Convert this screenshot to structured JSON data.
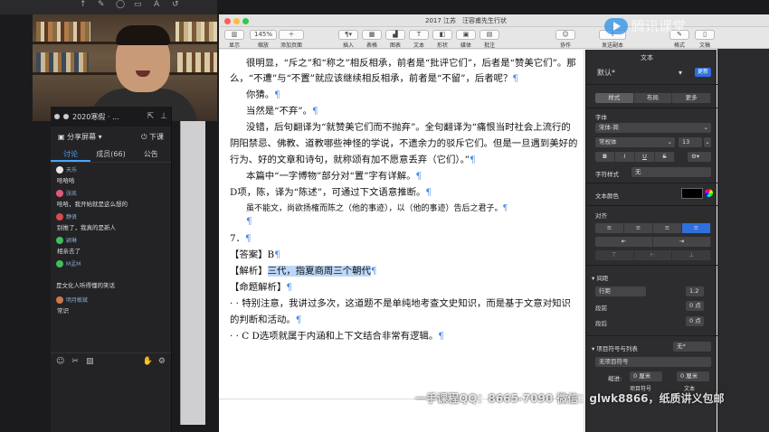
{
  "doc_title": "2017 江苏　汪容甫先生行状",
  "toolbar": {
    "view": "显示",
    "zoom_value": "145%",
    "zoom": "缩放",
    "add_page": "添加页面",
    "insert": "插入",
    "table": "表格",
    "chart": "图表",
    "text": "文本",
    "shape": "形状",
    "media": "媒体",
    "comment": "批注",
    "collaborate": "协作",
    "publish": "发送副本",
    "format": "格式",
    "document": "文稿"
  },
  "document": {
    "lines": [
      "很明显，“斥之”和“称之”相反相承，前者是“批评它们”，后者是“赞美它们”。那",
      "么，“不遭”与“不置”就应该继续相反相承，前者是“不留”，后者呢？",
      "你猜。",
      "当然是“不弃”。",
      "没错，后句翻译为“就赞美它们而不抛弃”。全句翻译为“痛恨当时社会上流行的",
      "阴阳禁忌、佛教、道教哪些神怪的学说，不遗余力的驳斥它们。但是一旦遇到美好的",
      "行为、好的文章和诗句，就称颂有加不愿意丢弃（它们）。”",
      "本篇中“一字博物”部分对“置”字有详解。",
      "D项，陈，译为“陈述”，可通过下文语意推断。",
      "虽不能文，尚欲扬榷而陈之（他的事迹），以（他的事迹）告后之君子。",
      "7．",
      "【答案】B",
      "【解析】",
      "三代，指夏商周三个朝代",
      "【命题解析】",
      "· · 特别注意，我讲过多次，这道题不是单纯地考查文史知识，而是基于文意对知识",
      "的判断和活动。",
      "· · C D选项就属于内涵和上下文结合非常有逻辑。"
    ],
    "pilcrow": "¶"
  },
  "chat": {
    "class_title": "2020寒假 · ...",
    "share": "分享屏幕",
    "leave": "下课",
    "tabs": [
      "讨论",
      "成员(66)",
      "公告"
    ],
    "messages": [
      {
        "user": "天乐",
        "text": "哈哈哈",
        "color": "#e8e8e8"
      },
      {
        "user": "张凯",
        "text": "哈哈，我开始就是这么想的",
        "color": "#e05a7a"
      },
      {
        "user": "静贤",
        "text": "别推了，我真的是新人",
        "color": "#d94a4a"
      },
      {
        "user": "颖琳",
        "text": "相亲去了",
        "color": "#3fbf5a"
      },
      {
        "user": "M孟M",
        "text": "",
        "color": "#3fbf5a"
      }
    ],
    "plain_text": "是文化人听得懂的笑话",
    "messages2": [
      {
        "user": "明月敏斌",
        "text": "常识",
        "color": "#c97a4a"
      }
    ]
  },
  "inspector": {
    "header": "文本",
    "style_value": "默认*",
    "update": "更新",
    "tabs": [
      "样式",
      "布局",
      "更多"
    ],
    "font_label": "字体",
    "font_value": "宋体-简",
    "typeface_value": "常规体",
    "font_size": "13",
    "bold": "B",
    "italic": "I",
    "underline": "U",
    "strike": "S",
    "char_style_label": "字符样式",
    "char_style_value": "无",
    "text_color_label": "文本颜色",
    "align_label": "对齐",
    "spacing_label": "间距",
    "line_spacing_value": "行距",
    "line_spacing_num": "1.2",
    "before_label": "段前",
    "before_value": "0 点",
    "after_label": "段后",
    "after_value": "0 点",
    "list_label": "项目符号与列表",
    "list_value": "无*",
    "list_type": "无项目符号",
    "indent_label": "缩进:",
    "indent_value": "0 厘米",
    "indent_value2": "0 厘米",
    "bullet_label": "项目符号",
    "text_label": "文本"
  },
  "watermark": "一手课程QQ：8665-7090 微信：glwk8866，纸质讲义包邮",
  "logo_text": "腾讯课堂"
}
